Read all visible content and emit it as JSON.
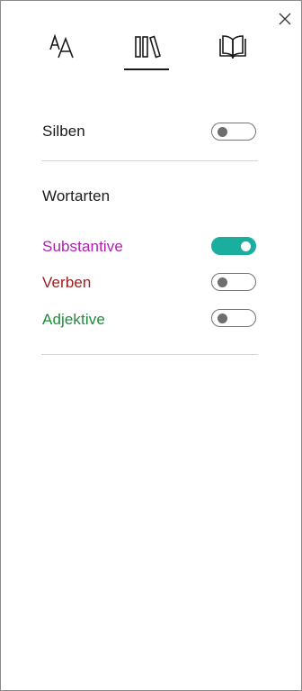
{
  "tabs": [
    {
      "name": "text-options",
      "icon": "text-size-icon",
      "selected": false
    },
    {
      "name": "grammar-options",
      "icon": "library-books-icon",
      "selected": true
    },
    {
      "name": "reading-preferences",
      "icon": "open-book-icon",
      "selected": false
    }
  ],
  "close_icon": "close-icon",
  "syllables": {
    "label": "Silben",
    "on": false
  },
  "parts_of_speech": {
    "heading": "Wortarten",
    "items": [
      {
        "label": "Substantive",
        "color": "#b01fb0",
        "on": true
      },
      {
        "label": "Verben",
        "color": "#9e1b1b",
        "on": false
      },
      {
        "label": "Adjektive",
        "color": "#1e8c3a",
        "on": false
      }
    ]
  },
  "colors": {
    "toggle_on": "#1aae9e",
    "toggle_off_border": "#757575",
    "divider": "#d4d4d4"
  }
}
